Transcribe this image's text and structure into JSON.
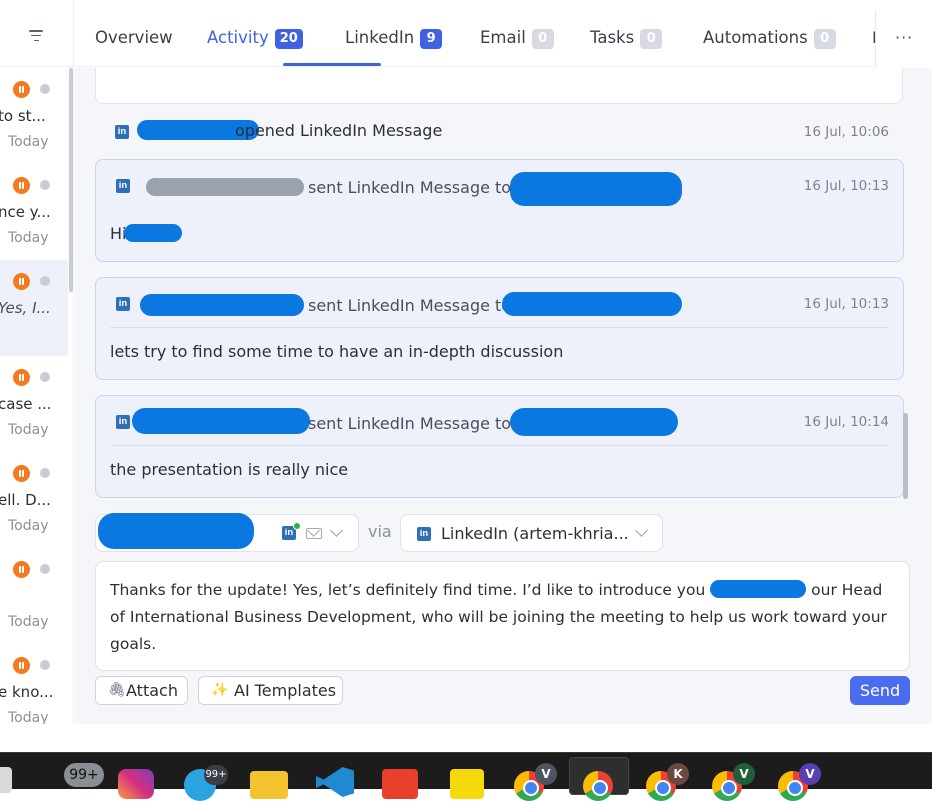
{
  "left_list": {
    "rows": [
      {
        "snippet": "to st...",
        "date": "Today",
        "italic": false
      },
      {
        "snippet": "nce y...",
        "date": "Today",
        "italic": false
      },
      {
        "snippet": "Yes, I...",
        "date": "",
        "italic": true
      },
      {
        "snippet": "case ...",
        "date": "Today",
        "italic": false
      },
      {
        "snippet": "ell. D...",
        "date": "Today",
        "italic": false
      },
      {
        "snippet": "",
        "date": "Today",
        "italic": false
      },
      {
        "snippet": "e kno...",
        "date": "Today",
        "italic": false
      }
    ]
  },
  "tabs": [
    {
      "label": "Overview",
      "badge": ""
    },
    {
      "label": "Activity",
      "badge": "20"
    },
    {
      "label": "LinkedIn",
      "badge": "9"
    },
    {
      "label": "Email",
      "badge": "0"
    },
    {
      "label": "Tasks",
      "badge": "0"
    },
    {
      "label": "Automations",
      "badge": "0"
    }
  ],
  "tab_overflow": "I",
  "more_label": "···",
  "feed": {
    "opened_event": {
      "text": "opened LinkedIn Message",
      "time": "16 Jul, 10:06"
    },
    "messages": [
      {
        "head": "sent LinkedIn Message to",
        "time": "16 Jul, 10:13",
        "body": "Hi"
      },
      {
        "head": "sent LinkedIn Message to",
        "time": "16 Jul, 10:13",
        "body": "lets try to find some time to have an in-depth discussion"
      },
      {
        "head": "sent LinkedIn Message to",
        "time": "16 Jul, 10:14",
        "body": "the presentation is really nice"
      }
    ]
  },
  "compose": {
    "via_label": "via",
    "channel_label": "LinkedIn (artem-khria...",
    "message_part1": "Thanks for the update! Yes, let’s definitely find time. I’d like to introduce you",
    "message_part2": "our Head of International Business Development, who will be joining the meeting to help us work toward your goals.",
    "attach_label": "Attach",
    "templates_label": "AI Templates",
    "send_label": "Send"
  },
  "taskbar": {
    "notif_badge": "99+",
    "telegram_badge": "99+",
    "profiles": [
      "V",
      "K",
      "V",
      "V"
    ],
    "colors": {
      "accent": "#3f63e0",
      "send": "#4a6cf0",
      "pause": "#f47a1f",
      "redaction": "#0a78e0"
    }
  }
}
